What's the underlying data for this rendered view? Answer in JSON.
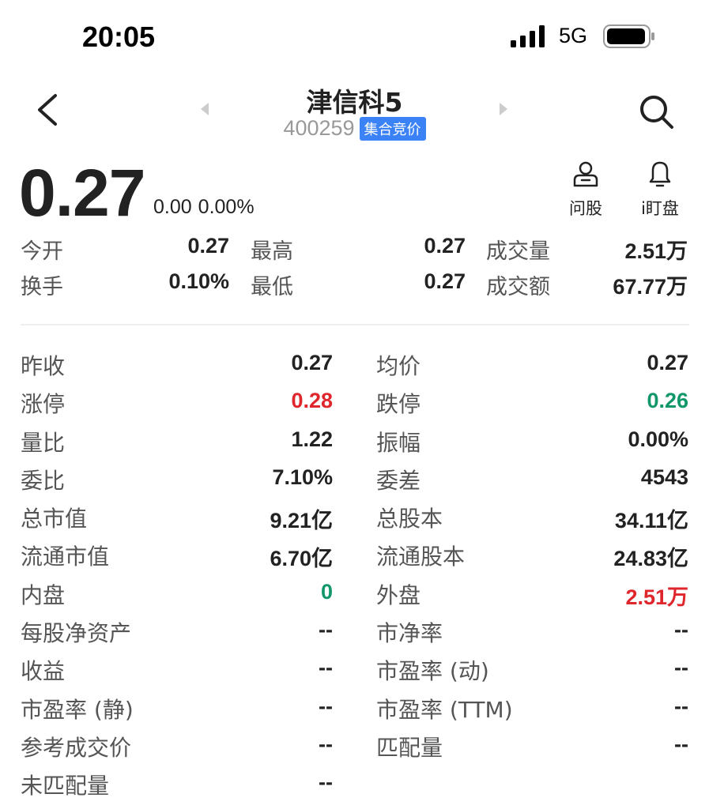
{
  "status_bar": {
    "time": "20:05",
    "network": "5G",
    "icons": [
      "signal-icon",
      "battery-icon"
    ]
  },
  "header": {
    "name": "津信科5",
    "code": "400259",
    "badge": "集合竞价",
    "icons": [
      "back-icon",
      "prev-arrow-icon",
      "next-arrow-icon",
      "search-icon"
    ]
  },
  "quote": {
    "price": "0.27",
    "change": "0.00",
    "change_pct": "0.00%"
  },
  "actions": {
    "ask": {
      "label": "问股",
      "icon": "person-icon"
    },
    "watch": {
      "label": "i盯盘",
      "icon": "bell-icon"
    }
  },
  "summary": {
    "rows": [
      [
        {
          "label": "今开",
          "value": "0.27"
        },
        {
          "label": "最高",
          "value": "0.27"
        },
        {
          "label": "成交量",
          "value": "2.51万"
        }
      ],
      [
        {
          "label": "换手",
          "value": "0.10%"
        },
        {
          "label": "最低",
          "value": "0.27"
        },
        {
          "label": "成交额",
          "value": "67.77万"
        }
      ]
    ]
  },
  "details": {
    "left": [
      {
        "label": "昨收",
        "value": "0.27"
      },
      {
        "label": "涨停",
        "value": "0.28"
      },
      {
        "label": "量比",
        "value": "1.22"
      },
      {
        "label": "委比",
        "value": "7.10%"
      },
      {
        "label": "总市值",
        "value": "9.21亿"
      },
      {
        "label": "流通市值",
        "value": "6.70亿"
      },
      {
        "label": "内盘",
        "value": "0"
      },
      {
        "label": "每股净资产",
        "value": "--"
      },
      {
        "label": "收益",
        "value": "--"
      },
      {
        "label": "市盈率 (静)",
        "value": "--"
      },
      {
        "label": "参考成交价",
        "value": "--"
      },
      {
        "label": "未匹配量",
        "value": "--"
      }
    ],
    "right": [
      {
        "label": "均价",
        "value": "0.27"
      },
      {
        "label": "跌停",
        "value": "0.26"
      },
      {
        "label": "振幅",
        "value": "0.00%"
      },
      {
        "label": "委差",
        "value": "4543"
      },
      {
        "label": "总股本",
        "value": "34.11亿"
      },
      {
        "label": "流通股本",
        "value": "24.83亿"
      },
      {
        "label": "外盘",
        "value": "2.51万"
      },
      {
        "label": "市净率",
        "value": "--"
      },
      {
        "label": "市盈率 (动)",
        "value": "--"
      },
      {
        "label": "市盈率 (TTM)",
        "value": "--"
      },
      {
        "label": "匹配量",
        "value": "--"
      }
    ]
  },
  "colors": {
    "up": "#e0262d",
    "down": "#12976b",
    "badge": "#3b82f6"
  }
}
